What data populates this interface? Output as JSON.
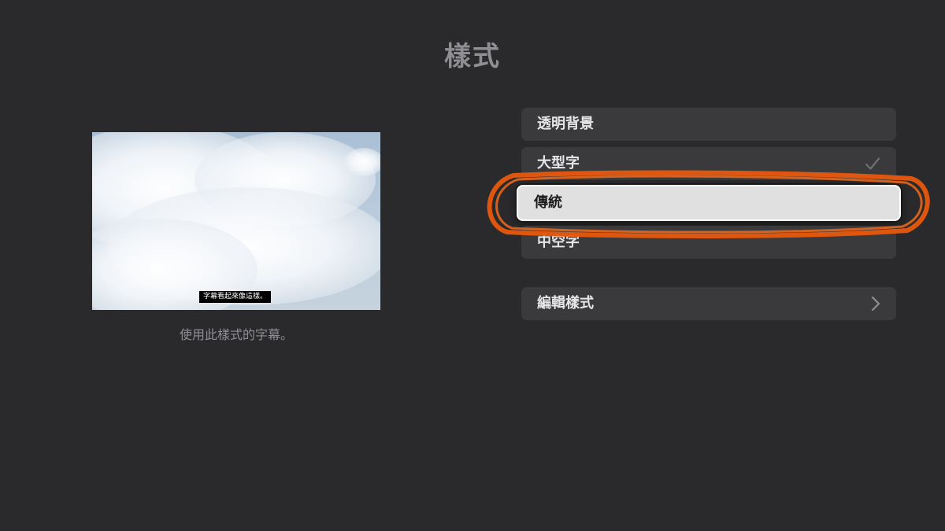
{
  "title": "樣式",
  "preview": {
    "subtitle_sample": "字幕看起來像這樣。",
    "caption": "使用此樣式的字幕。"
  },
  "styles": [
    {
      "label": "透明背景",
      "selected": false,
      "focused": false
    },
    {
      "label": "大型字",
      "selected": true,
      "focused": false
    },
    {
      "label": "傳統",
      "selected": false,
      "focused": true
    },
    {
      "label": "中空字",
      "selected": false,
      "focused": false
    }
  ],
  "edit_style": {
    "label": "編輯樣式"
  },
  "icons": {
    "selected": "checkmark-icon",
    "edit": "chevron-right-icon"
  },
  "colors": {
    "background": "#2a2a2c",
    "list_item": "#3a3a3d",
    "focused_item": "#e0e0e0",
    "annotation": "#e8590c"
  }
}
